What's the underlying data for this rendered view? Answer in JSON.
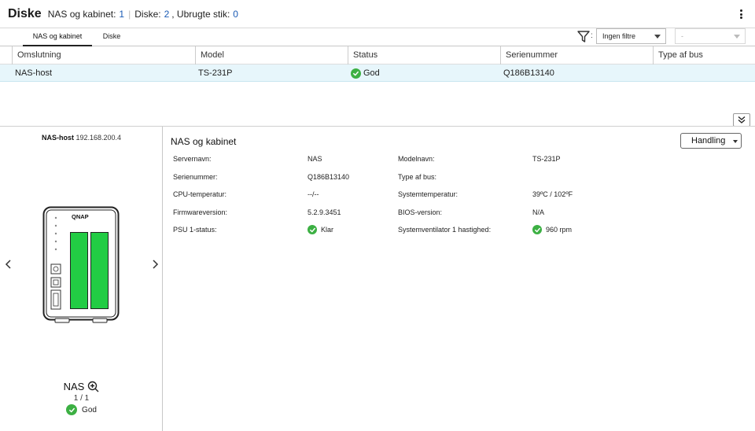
{
  "header": {
    "title": "Diske",
    "nas_label": "NAS og kabinet:",
    "nas_count": "1",
    "disks_label": "Diske:",
    "disks_count": "2",
    "unused_label": ", Ubrugte stik:",
    "unused_count": "0"
  },
  "tabs": [
    {
      "label": "NAS og kabinet",
      "active": true
    },
    {
      "label": "Diske",
      "active": false
    }
  ],
  "filter": {
    "colon": ":",
    "selected": "Ingen filtre",
    "secondary": "-"
  },
  "table": {
    "columns": [
      "Omslutning",
      "Model",
      "Status",
      "Serienummer",
      "Type af bus"
    ],
    "rows": [
      {
        "enclosure": "NAS-host",
        "model": "TS-231P",
        "status": "God",
        "serial": "Q186B13140",
        "bus": ""
      }
    ]
  },
  "left_panel": {
    "host_name": "NAS-host",
    "host_ip": "192.168.200.4",
    "device_name": "NAS",
    "device_brand": "QNAP",
    "page": "1 / 1",
    "status": "God"
  },
  "details": {
    "title": "NAS og kabinet",
    "action_label": "Handling",
    "fields": [
      {
        "label": "Servernavn:",
        "value": "NAS"
      },
      {
        "label": "Modelnavn:",
        "value": "TS-231P"
      },
      {
        "label": "Serienummer:",
        "value": "Q186B13140"
      },
      {
        "label": "Type af bus:",
        "value": ""
      },
      {
        "label": "CPU-temperatur:",
        "value": "--/--"
      },
      {
        "label": "Systemtemperatur:",
        "value": "39ºC / 102ºF"
      },
      {
        "label": "Firmwareversion:",
        "value": "5.2.9.3451"
      },
      {
        "label": "BIOS-version:",
        "value": "N/A"
      },
      {
        "label": "PSU 1-status:",
        "value": "Klar"
      },
      {
        "label": "Systemventilator 1 hastighed:",
        "value": "960 rpm"
      }
    ]
  },
  "colors": {
    "accent_blue": "#1a5bb5",
    "ok_green": "#3cb043",
    "selected_row": "#e7f6fb",
    "drive_green": "#22cc44"
  }
}
